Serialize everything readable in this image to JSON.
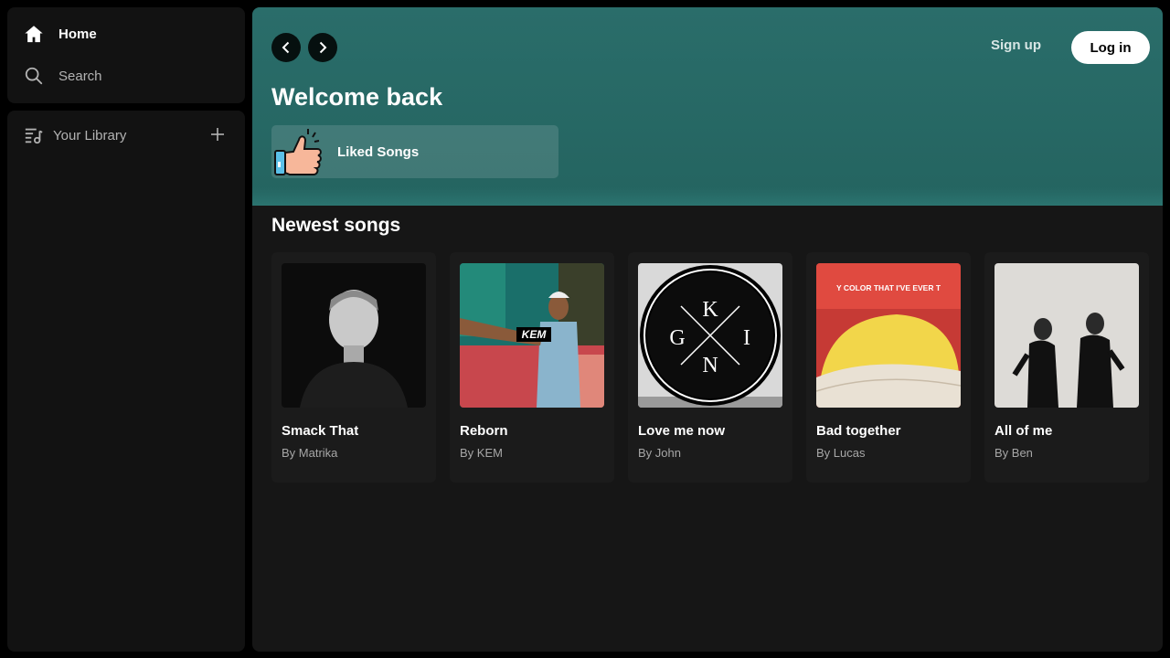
{
  "sidebar": {
    "home_label": "Home",
    "search_label": "Search",
    "library_label": "Your Library"
  },
  "header": {
    "signup_label": "Sign up",
    "login_label": "Log in"
  },
  "hero": {
    "welcome": "Welcome back",
    "liked_songs_label": "Liked Songs"
  },
  "section": {
    "title": "Newest songs"
  },
  "songs": [
    {
      "title": "Smack That",
      "artist": "By Matrika"
    },
    {
      "title": "Reborn",
      "artist": "By KEM",
      "cover_text": "KEM"
    },
    {
      "title": "Love me now",
      "artist": "By John",
      "cover_letters": [
        "K",
        "G",
        "I",
        "N"
      ]
    },
    {
      "title": "Bad together",
      "artist": "By Lucas",
      "cover_text": "Y COLOR THAT I'VE EVER T"
    },
    {
      "title": "All of me",
      "artist": "By Ben"
    }
  ],
  "colors": {
    "hero": "#2a6d6a",
    "panel": "#121212",
    "main": "#161616"
  },
  "icons": [
    "home-icon",
    "search-icon",
    "library-icon",
    "plus-icon",
    "chevron-left-icon",
    "chevron-right-icon",
    "thumbs-up-icon"
  ]
}
